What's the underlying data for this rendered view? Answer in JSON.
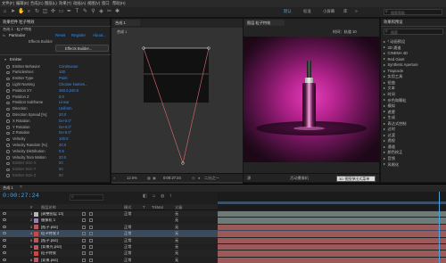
{
  "menu": {
    "items": [
      "文件(F)",
      "编辑(E)",
      "合成(C)",
      "图层(L)",
      "效果(T)",
      "动画(A)",
      "视图(V)",
      "窗口",
      "帮助(H)"
    ]
  },
  "toolbar": {
    "workspaces": [
      "默认",
      "标准",
      "小屏幕",
      "库"
    ],
    "active_workspace": "默认",
    "search_placeholder": "搜索帮助"
  },
  "effects_panel": {
    "tab": "效果控件 粒子特效",
    "layer_path": "合成 1 · 粒子特效",
    "effect_name": "Particular",
    "reset_label": "Reset",
    "register_label": "Register",
    "about_label": "About...",
    "builder_header": "Effects Builder",
    "builder_button": "Effects Builder...",
    "emitter_section": "Emitter",
    "rows": [
      {
        "label": "Emitter Behavior",
        "value": "Continuous"
      },
      {
        "label": "Particles/sec",
        "value": "100"
      },
      {
        "label": "Emitter Type",
        "value": "Point"
      },
      {
        "label": "Light Naming",
        "value": "Choose Names..."
      },
      {
        "label": "Position XY",
        "value": "360.0,240.0"
      },
      {
        "label": "Position Z",
        "value": "0.0"
      },
      {
        "label": "Position Subframe",
        "value": "Linear"
      },
      {
        "label": "Direction",
        "value": "Uniform"
      },
      {
        "label": "Direction Spread [%]",
        "value": "20.0"
      },
      {
        "label": "X Rotation",
        "value": "0x+0.0°"
      },
      {
        "label": "Y Rotation",
        "value": "0x+0.0°"
      },
      {
        "label": "Z Rotation",
        "value": "0x+0.0°"
      },
      {
        "label": "Velocity",
        "value": "100.0"
      },
      {
        "label": "Velocity Random [%]",
        "value": "20.0"
      },
      {
        "label": "Velocity Distribution",
        "value": "0.5"
      },
      {
        "label": "Velocity from Motion",
        "value": "20.0"
      },
      {
        "label": "Emitter Size X",
        "value": "50"
      },
      {
        "label": "Emitter Size Y",
        "value": "50"
      },
      {
        "label": "Emitter Size Z",
        "value": "50"
      }
    ]
  },
  "comp_viewer": {
    "tab": "合成 1",
    "breadcrumb": "合成 1",
    "zoom": "12.5%",
    "timecode": "0:00:27:24",
    "quality": "二分之一",
    "camera": "活动摄像机"
  },
  "footage_viewer": {
    "tab": "图层 粒子特效",
    "header": "时间：轨道 10",
    "source": "源"
  },
  "effects_presets": {
    "tab": "效果和预设",
    "search_placeholder": "搜索",
    "items": [
      "* 动画预设",
      "3D 通道",
      "CINEMA 4D",
      "Red Giant",
      "Synthetic Aperture",
      "Trapcode",
      "实用工具",
      "扭曲",
      "文本",
      "时间",
      "杂色和颗粒",
      "模拟",
      "遮罩",
      "生成",
      "表达式控制",
      "过时",
      "过渡",
      "透视",
      "通道",
      "颜色校正",
      "音频",
      "风格化"
    ]
  },
  "timeline": {
    "tab": "合成 1",
    "timecode": "0:00:27:24",
    "columns": [
      "#",
      "图层名称",
      "模式",
      "T",
      "TrkMat",
      "父级"
    ],
    "layers": [
      {
        "num": "1",
        "name": "[调整图层 13]",
        "mode": "正常",
        "parent": "无",
        "color": "#b5b5b5",
        "bar": "#6e7b78"
      },
      {
        "num": "2",
        "name": "摄像机 1",
        "mode": "",
        "parent": "无",
        "color": "#9e7fb8",
        "bar": "#6e7b78"
      },
      {
        "num": "3",
        "name": "[瓶子.psd]",
        "mode": "正常",
        "parent": "无",
        "color": "#b55b5b",
        "bar": "#9c5959"
      },
      {
        "num": "4",
        "name": "粒子特效 2",
        "mode": "正常",
        "parent": "无",
        "color": "#c44a4a",
        "bar": "#9c5959"
      },
      {
        "num": "5",
        "name": "[瓶子.psd]",
        "mode": "正常",
        "parent": "无",
        "color": "#b55b5b",
        "bar": "#9c5959"
      },
      {
        "num": "6",
        "name": "[背景光.psd]",
        "mode": "正常",
        "parent": "无",
        "color": "#b55b5b",
        "bar": "#9c5959"
      },
      {
        "num": "7",
        "name": "粒子特效",
        "mode": "正常",
        "parent": "无",
        "color": "#c44a4a",
        "bar": "#9c5959"
      },
      {
        "num": "8",
        "name": "[背景.psd]",
        "mode": "正常",
        "parent": "无",
        "color": "#b55b5b",
        "bar": "#9c5959"
      }
    ],
    "tooltip": "3D 视图弹出式菜单"
  }
}
